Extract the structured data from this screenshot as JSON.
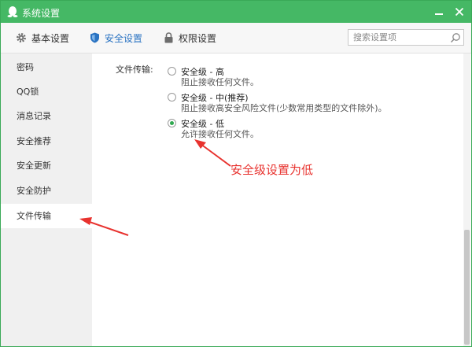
{
  "window": {
    "title": "系统设置",
    "accent_color": "#45b865",
    "controls": [
      "minimize-icon",
      "close-icon"
    ]
  },
  "toolbar": {
    "tabs": [
      {
        "label": "基本设置",
        "icon": "gear-icon",
        "active": false
      },
      {
        "label": "安全设置",
        "icon": "shield-icon",
        "active": true
      },
      {
        "label": "权限设置",
        "icon": "lock-icon",
        "active": false
      }
    ],
    "search": {
      "placeholder": "搜索设置项",
      "value": "",
      "icon": "search-icon"
    }
  },
  "sidebar": {
    "items": [
      {
        "label": "密码",
        "active": false
      },
      {
        "label": "QQ锁",
        "active": false
      },
      {
        "label": "消息记录",
        "active": false
      },
      {
        "label": "安全推荐",
        "active": false
      },
      {
        "label": "安全更新",
        "active": false
      },
      {
        "label": "安全防护",
        "active": false
      },
      {
        "label": "文件传输",
        "active": true
      }
    ]
  },
  "content": {
    "section_label": "文件传输:",
    "options": [
      {
        "title": "安全级 - 高",
        "desc": "阻止接收任何文件。",
        "selected": false
      },
      {
        "title": "安全级 - 中(推荐)",
        "desc": "阻止接收高安全风险文件(少数常用类型的文件除外)。",
        "selected": false
      },
      {
        "title": "安全级 - 低",
        "desc": "允许接收任何文件。",
        "selected": true
      }
    ]
  },
  "annotations": {
    "text": "安全级设置为低",
    "color": "#e8322e"
  }
}
